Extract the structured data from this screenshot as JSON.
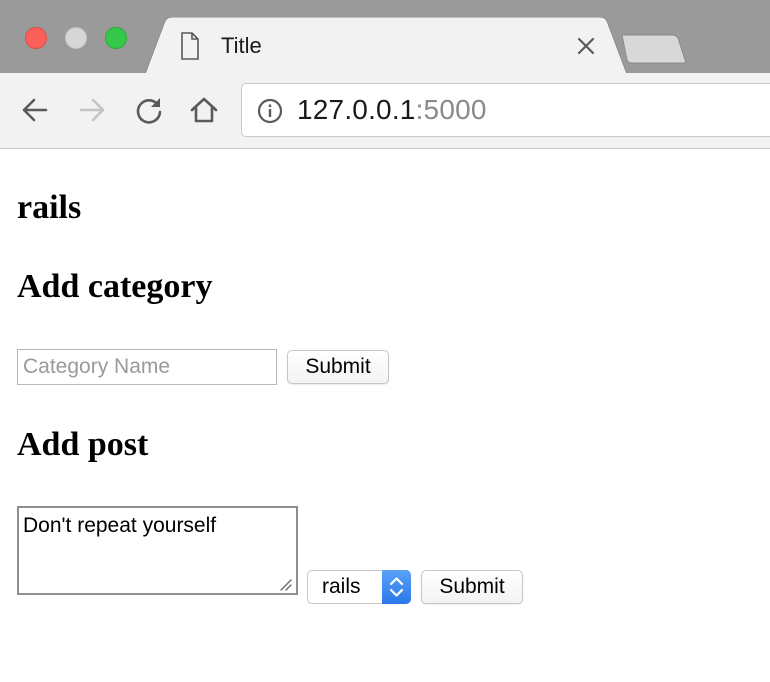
{
  "browser": {
    "tab": {
      "title": "Title"
    },
    "address": {
      "host": "127.0.0.1",
      "port": ":5000"
    }
  },
  "page": {
    "heading_rails": "rails",
    "add_category": {
      "heading": "Add category",
      "input_placeholder": "Category Name",
      "input_value": "",
      "submit_label": "Submit"
    },
    "add_post": {
      "heading": "Add post",
      "textarea_value": "Don't repeat yourself",
      "category_select": {
        "selected": "rails"
      },
      "submit_label": "Submit"
    }
  },
  "colors": {
    "titlebar": "#9a9a9a",
    "toolbar": "#f2f2f2",
    "close": "#fc5f57",
    "minimize_inactive": "#d6d6d6",
    "maximize": "#35c84a",
    "select_accent": "#2a78e8"
  }
}
